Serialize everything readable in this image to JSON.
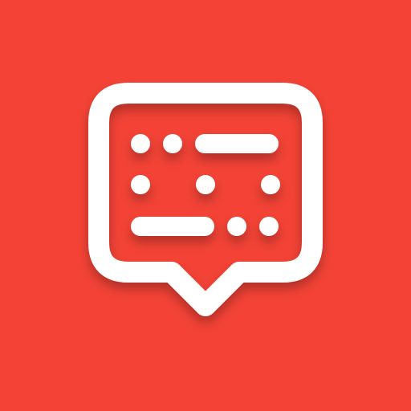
{
  "icon": {
    "name": "morse-code-chat-icon",
    "background_color": "#F44336",
    "foreground_color": "#FFFFFF",
    "morse_rows": [
      [
        "dot",
        "dot",
        "dash"
      ],
      [
        "dot",
        "dot",
        "dot"
      ],
      [
        "dash",
        "dot",
        "dot"
      ]
    ]
  }
}
